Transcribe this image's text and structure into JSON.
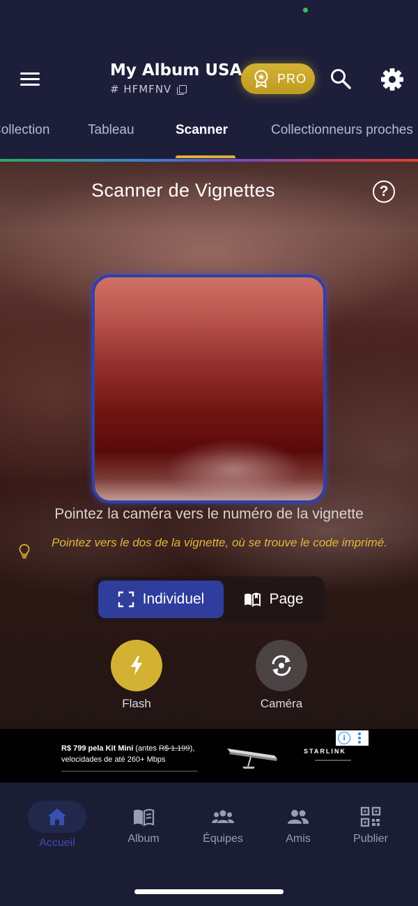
{
  "app": {
    "title": "My Album USA",
    "code": "# HFMFNV",
    "pro_label": "PRO"
  },
  "tabs": [
    {
      "label": "Collection"
    },
    {
      "label": "Tableau"
    },
    {
      "label": "Scanner",
      "active": true
    },
    {
      "label": "Collectionneurs proches"
    }
  ],
  "scanner": {
    "title": "Scanner de Vignettes",
    "help_symbol": "?",
    "instruction": "Pointez la caméra vers le numéro de la vignette",
    "hint": "Pointez vers le dos de la vignette, où se trouve le code imprimé.",
    "modes": [
      {
        "label": "Individuel",
        "selected": true
      },
      {
        "label": "Page",
        "selected": false
      }
    ],
    "flash_label": "Flash",
    "camera_label": "Caméra"
  },
  "ad": {
    "price_bold": "R$ 799 pela Kit Mini",
    "price_prefix": " (antes ",
    "price_old": "R$ 1.199",
    "price_suffix": "),",
    "line2": "velocidades de até 260+ Mbps",
    "brand": "STARLINK",
    "info_symbol": "i"
  },
  "bottom_nav": [
    {
      "label": "Accueil",
      "icon": "home-icon",
      "active": true
    },
    {
      "label": "Album",
      "icon": "album-book-icon",
      "active": false
    },
    {
      "label": "Équipes",
      "icon": "teams-icon",
      "active": false
    },
    {
      "label": "Amis",
      "icon": "friends-icon",
      "active": false
    },
    {
      "label": "Publier",
      "icon": "qr-code-icon",
      "active": false
    }
  ],
  "colors": {
    "accent_gold": "#d3b132",
    "accent_blue": "#2f3d9c",
    "hint_yellow": "#e2b53a",
    "appbar_bg": "#1d1f3a"
  }
}
